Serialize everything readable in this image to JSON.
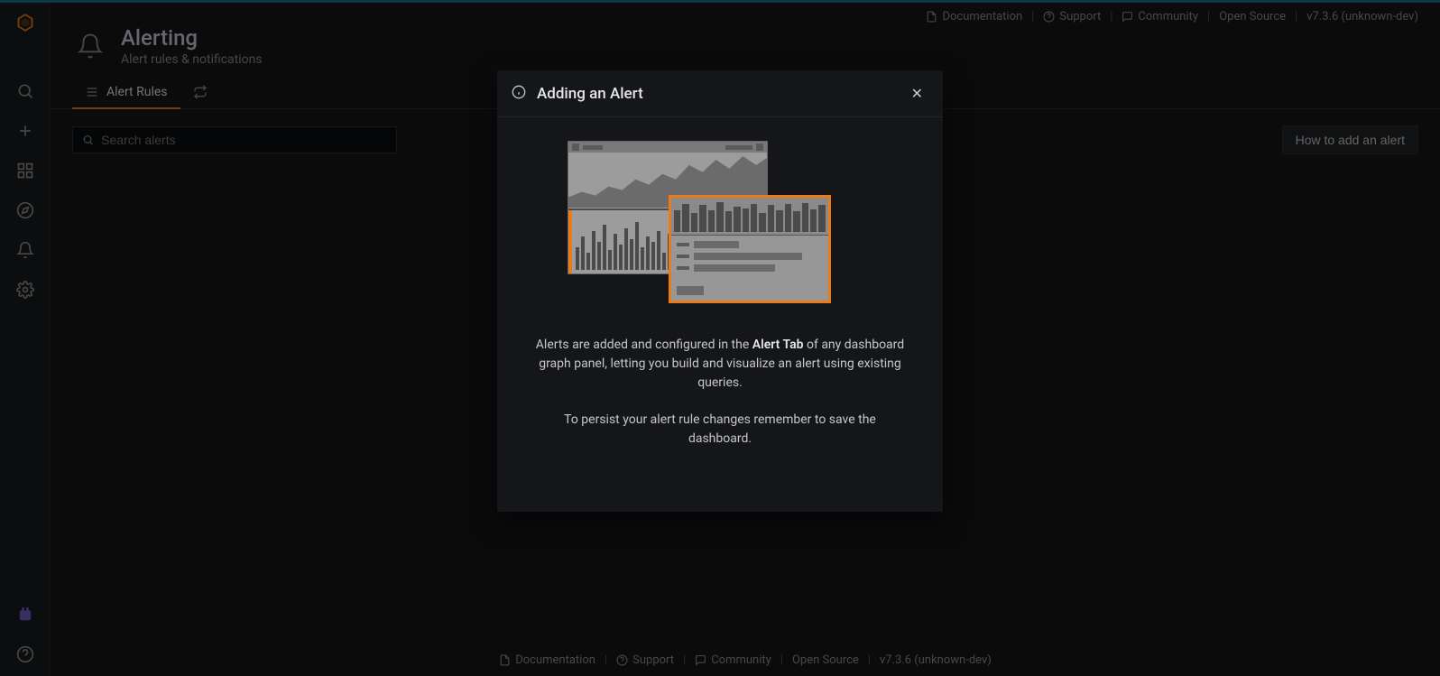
{
  "help_links": {
    "documentation": "Documentation",
    "support": "Support",
    "community": "Community",
    "opensource": "Open Source",
    "version": "v7.3.6 (unknown-dev)"
  },
  "page": {
    "title": "Alerting",
    "subtitle": "Alert rules & notifications"
  },
  "tabs": {
    "alert_rules": "Alert Rules"
  },
  "search": {
    "placeholder": "Search alerts"
  },
  "buttons": {
    "how_to_add": "How to add an alert"
  },
  "modal": {
    "title": "Adding an Alert",
    "p1_a": "Alerts are added and configured in the ",
    "p1_bold": "Alert Tab",
    "p1_b": " of any dashboard graph panel, letting you build and visualize an alert using existing queries.",
    "p2": "To persist your alert rule changes remember to save the dashboard."
  },
  "footer": {
    "documentation": "Documentation",
    "support": "Support",
    "community": "Community",
    "opensource": "Open Source",
    "version": "v7.3.6 (unknown-dev)"
  }
}
